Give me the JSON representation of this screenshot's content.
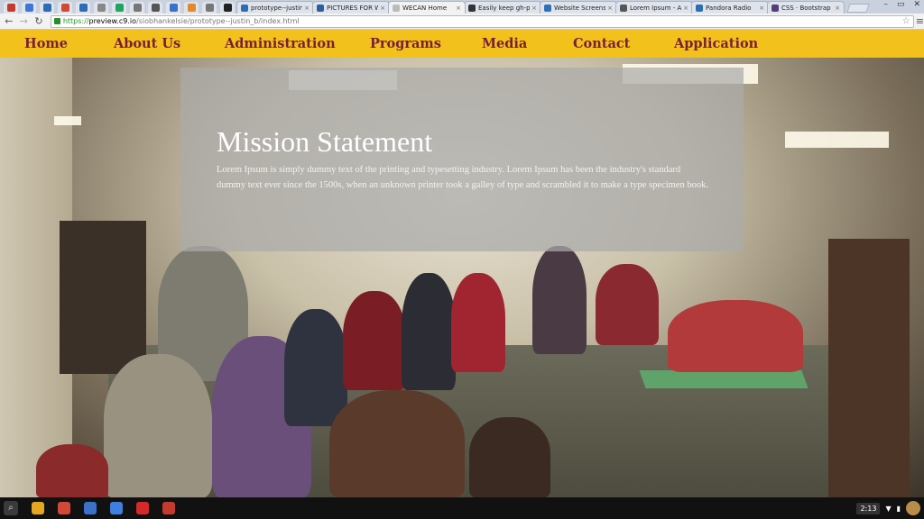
{
  "browser": {
    "pinned_tabs": [
      {
        "icon": "gmail-red-icon",
        "color": "#c33a2f"
      },
      {
        "icon": "ai-icon",
        "color": "#3d78d8"
      },
      {
        "icon": "outlook-icon",
        "color": "#2d6db7"
      },
      {
        "icon": "gmail-icon",
        "color": "#d14836"
      },
      {
        "icon": "outlook-icon-2",
        "color": "#2d6db7"
      },
      {
        "icon": "document-icon",
        "color": "#888888"
      },
      {
        "icon": "drive-icon",
        "color": "#1fa463"
      },
      {
        "icon": "folder-icon",
        "color": "#777777"
      },
      {
        "icon": "puzzle-icon",
        "color": "#555555"
      },
      {
        "icon": "google-plus-icon",
        "color": "#3b71c8"
      },
      {
        "icon": "orange-circle-icon",
        "color": "#e08a2c"
      },
      {
        "icon": "grid-icon",
        "color": "#777777"
      },
      {
        "icon": "black-app-icon",
        "color": "#222222"
      }
    ],
    "tabs": [
      {
        "title": "prototype--justin_b",
        "color": "#2d6db7",
        "active": false
      },
      {
        "title": "PICTURES FOR WE",
        "color": "#2c5e9e",
        "active": false
      },
      {
        "title": "WECAN Home",
        "color": "#bbbbbb",
        "active": true
      },
      {
        "title": "Easily keep gh-pag",
        "color": "#333333",
        "active": false
      },
      {
        "title": "Website Screensh",
        "color": "#2f6fb6",
        "active": false
      },
      {
        "title": "Lorem Ipsum - All t",
        "color": "#555555",
        "active": false
      },
      {
        "title": "Pandora Radio",
        "color": "#2a6db0",
        "active": false
      },
      {
        "title": "CSS · Bootstrap",
        "color": "#563d7c",
        "active": false
      }
    ],
    "window_controls": [
      "–",
      "▭",
      "✕"
    ],
    "url": {
      "scheme": "https://",
      "host": "preview.c9.io",
      "path": "/siobhankelsie/prototype--justin_b/index.html"
    }
  },
  "nav": {
    "items": [
      {
        "label": "Home",
        "key": "home"
      },
      {
        "label": "About Us",
        "key": "about"
      },
      {
        "label": "Administration",
        "key": "administration"
      },
      {
        "label": "Programs",
        "key": "programs"
      },
      {
        "label": "Media",
        "key": "media"
      },
      {
        "label": "Contact",
        "key": "contact"
      },
      {
        "label": "Application",
        "key": "application"
      }
    ]
  },
  "mission": {
    "title": "Mission Statement",
    "body": "Lorem Ipsum is simply dummy text of the printing and typesetting industry. Lorem Ipsum has been the industry's standard dummy text ever since the 1500s, when an unknown printer took a galley of type and scrambled it to make a type specimen book."
  },
  "shelf": {
    "apps": [
      {
        "icon": "chrome-icon",
        "color": "#e5a620"
      },
      {
        "icon": "gmail-icon",
        "color": "#d14836"
      },
      {
        "icon": "google-search-icon",
        "color": "#3b71c8"
      },
      {
        "icon": "docs-icon",
        "color": "#3f7fe0"
      },
      {
        "icon": "youtube-icon",
        "color": "#d62a2a"
      },
      {
        "icon": "photos-icon",
        "color": "#c33a2f"
      }
    ],
    "clock": "2:13"
  }
}
